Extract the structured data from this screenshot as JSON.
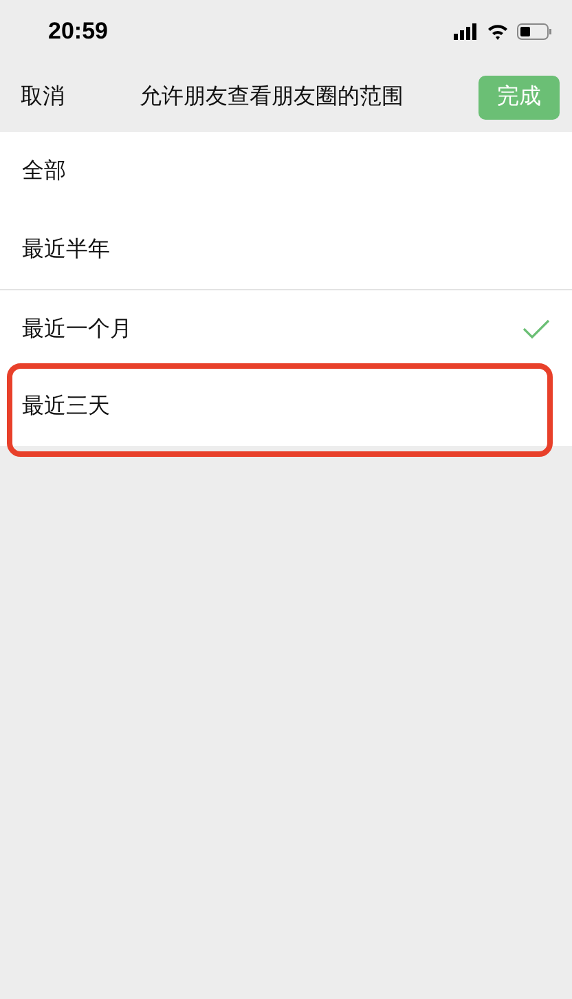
{
  "status_bar": {
    "time": "20:59"
  },
  "nav": {
    "cancel": "取消",
    "title": "允许朋友查看朋友圈的范围",
    "done": "完成"
  },
  "options": [
    {
      "label": "全部",
      "selected": false,
      "highlighted": false
    },
    {
      "label": "最近半年",
      "selected": false,
      "highlighted": false
    },
    {
      "label": "最近一个月",
      "selected": true,
      "highlighted": false
    },
    {
      "label": "最近三天",
      "selected": false,
      "highlighted": true
    }
  ]
}
